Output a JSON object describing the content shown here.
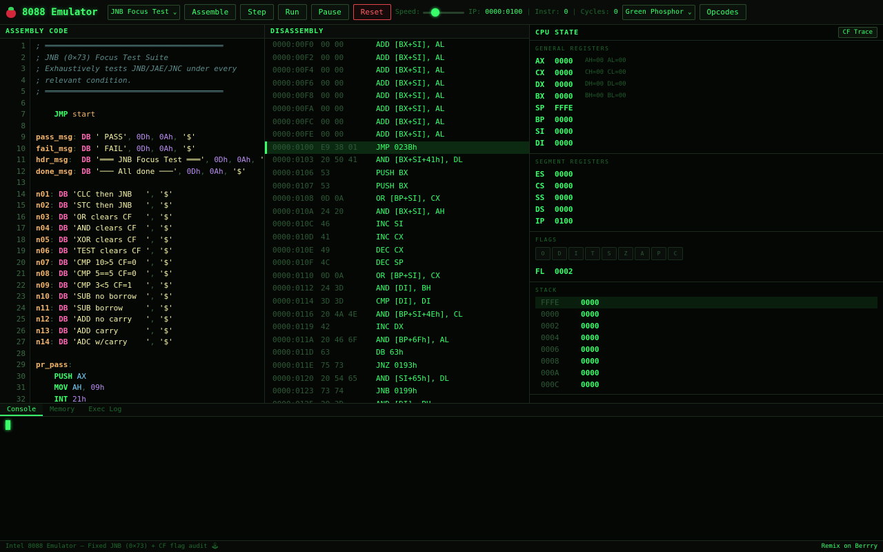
{
  "topbar": {
    "title": "8088 Emulator",
    "logo_icon": "strawberry-icon",
    "program_select": "JNB Focus Test",
    "assemble": "Assemble",
    "step": "Step",
    "run": "Run",
    "pause": "Pause",
    "reset": "Reset",
    "speed_label": "Speed:",
    "speed_level_fraction": 0.25,
    "ip_label": "IP:",
    "ip_value": "0000:0100",
    "instr_label": "Instr:",
    "instr_value": "0",
    "cycles_label": "Cycles:",
    "cycles_value": "0",
    "theme_select": "Green Phosphor",
    "opcodes": "Opcodes"
  },
  "code": {
    "header": "ASSEMBLY CODE",
    "lines": [
      [
        [
          "c",
          "; ═══════════════════════════════════════"
        ]
      ],
      [
        [
          "c",
          "; JNB (0×73) Focus Test Suite"
        ]
      ],
      [
        [
          "c",
          "; Exhaustively tests JNB/JAE/JNC under every"
        ]
      ],
      [
        [
          "c",
          "; relevant condition."
        ]
      ],
      [
        [
          "c",
          "; ═══════════════════════════════════════"
        ]
      ],
      [],
      [
        [
          "t",
          "    "
        ],
        [
          "o",
          "JMP"
        ],
        [
          "t",
          " "
        ],
        [
          "i",
          "start"
        ]
      ],
      [],
      [
        [
          "l",
          "pass_msg"
        ],
        [
          "p",
          ": "
        ],
        [
          "k",
          "DB"
        ],
        [
          "t",
          " "
        ],
        [
          "s",
          "' PASS'"
        ],
        [
          "p",
          ", "
        ],
        [
          "n",
          "0Dh"
        ],
        [
          "p",
          ", "
        ],
        [
          "n",
          "0Ah"
        ],
        [
          "p",
          ", "
        ],
        [
          "s",
          "'$'"
        ]
      ],
      [
        [
          "l",
          "fail_msg"
        ],
        [
          "p",
          ": "
        ],
        [
          "k",
          "DB"
        ],
        [
          "t",
          " "
        ],
        [
          "s",
          "' FAIL'"
        ],
        [
          "p",
          ", "
        ],
        [
          "n",
          "0Dh"
        ],
        [
          "p",
          ", "
        ],
        [
          "n",
          "0Ah"
        ],
        [
          "p",
          ", "
        ],
        [
          "s",
          "'$'"
        ]
      ],
      [
        [
          "l",
          "hdr_msg"
        ],
        [
          "p",
          ":  "
        ],
        [
          "k",
          "DB"
        ],
        [
          "t",
          " "
        ],
        [
          "s",
          "'═══ JNB Focus Test ═══'"
        ],
        [
          "p",
          ", "
        ],
        [
          "n",
          "0Dh"
        ],
        [
          "p",
          ", "
        ],
        [
          "n",
          "0Ah"
        ],
        [
          "p",
          ", "
        ],
        [
          "s",
          "'$'"
        ]
      ],
      [
        [
          "l",
          "done_msg"
        ],
        [
          "p",
          ": "
        ],
        [
          "k",
          "DB"
        ],
        [
          "t",
          " "
        ],
        [
          "s",
          "'─── All done ───'"
        ],
        [
          "p",
          ", "
        ],
        [
          "n",
          "0Dh"
        ],
        [
          "p",
          ", "
        ],
        [
          "n",
          "0Ah"
        ],
        [
          "p",
          ", "
        ],
        [
          "s",
          "'$'"
        ]
      ],
      [],
      [
        [
          "l",
          "n01"
        ],
        [
          "p",
          ": "
        ],
        [
          "k",
          "DB"
        ],
        [
          "t",
          " "
        ],
        [
          "s",
          "'CLC then JNB   '"
        ],
        [
          "p",
          ", "
        ],
        [
          "s",
          "'$'"
        ]
      ],
      [
        [
          "l",
          "n02"
        ],
        [
          "p",
          ": "
        ],
        [
          "k",
          "DB"
        ],
        [
          "t",
          " "
        ],
        [
          "s",
          "'STC then JNB   '"
        ],
        [
          "p",
          ", "
        ],
        [
          "s",
          "'$'"
        ]
      ],
      [
        [
          "l",
          "n03"
        ],
        [
          "p",
          ": "
        ],
        [
          "k",
          "DB"
        ],
        [
          "t",
          " "
        ],
        [
          "s",
          "'OR clears CF   '"
        ],
        [
          "p",
          ", "
        ],
        [
          "s",
          "'$'"
        ]
      ],
      [
        [
          "l",
          "n04"
        ],
        [
          "p",
          ": "
        ],
        [
          "k",
          "DB"
        ],
        [
          "t",
          " "
        ],
        [
          "s",
          "'AND clears CF  '"
        ],
        [
          "p",
          ", "
        ],
        [
          "s",
          "'$'"
        ]
      ],
      [
        [
          "l",
          "n05"
        ],
        [
          "p",
          ": "
        ],
        [
          "k",
          "DB"
        ],
        [
          "t",
          " "
        ],
        [
          "s",
          "'XOR clears CF  '"
        ],
        [
          "p",
          ", "
        ],
        [
          "s",
          "'$'"
        ]
      ],
      [
        [
          "l",
          "n06"
        ],
        [
          "p",
          ": "
        ],
        [
          "k",
          "DB"
        ],
        [
          "t",
          " "
        ],
        [
          "s",
          "'TEST clears CF '"
        ],
        [
          "p",
          ", "
        ],
        [
          "s",
          "'$'"
        ]
      ],
      [
        [
          "l",
          "n07"
        ],
        [
          "p",
          ": "
        ],
        [
          "k",
          "DB"
        ],
        [
          "t",
          " "
        ],
        [
          "s",
          "'CMP 10>5 CF=0  '"
        ],
        [
          "p",
          ", "
        ],
        [
          "s",
          "'$'"
        ]
      ],
      [
        [
          "l",
          "n08"
        ],
        [
          "p",
          ": "
        ],
        [
          "k",
          "DB"
        ],
        [
          "t",
          " "
        ],
        [
          "s",
          "'CMP 5==5 CF=0  '"
        ],
        [
          "p",
          ", "
        ],
        [
          "s",
          "'$'"
        ]
      ],
      [
        [
          "l",
          "n09"
        ],
        [
          "p",
          ": "
        ],
        [
          "k",
          "DB"
        ],
        [
          "t",
          " "
        ],
        [
          "s",
          "'CMP 3<5 CF=1   '"
        ],
        [
          "p",
          ", "
        ],
        [
          "s",
          "'$'"
        ]
      ],
      [
        [
          "l",
          "n10"
        ],
        [
          "p",
          ": "
        ],
        [
          "k",
          "DB"
        ],
        [
          "t",
          " "
        ],
        [
          "s",
          "'SUB no borrow  '"
        ],
        [
          "p",
          ", "
        ],
        [
          "s",
          "'$'"
        ]
      ],
      [
        [
          "l",
          "n11"
        ],
        [
          "p",
          ": "
        ],
        [
          "k",
          "DB"
        ],
        [
          "t",
          " "
        ],
        [
          "s",
          "'SUB borrow     '"
        ],
        [
          "p",
          ", "
        ],
        [
          "s",
          "'$'"
        ]
      ],
      [
        [
          "l",
          "n12"
        ],
        [
          "p",
          ": "
        ],
        [
          "k",
          "DB"
        ],
        [
          "t",
          " "
        ],
        [
          "s",
          "'ADD no carry   '"
        ],
        [
          "p",
          ", "
        ],
        [
          "s",
          "'$'"
        ]
      ],
      [
        [
          "l",
          "n13"
        ],
        [
          "p",
          ": "
        ],
        [
          "k",
          "DB"
        ],
        [
          "t",
          " "
        ],
        [
          "s",
          "'ADD carry      '"
        ],
        [
          "p",
          ", "
        ],
        [
          "s",
          "'$'"
        ]
      ],
      [
        [
          "l",
          "n14"
        ],
        [
          "p",
          ": "
        ],
        [
          "k",
          "DB"
        ],
        [
          "t",
          " "
        ],
        [
          "s",
          "'ADC w/carry    '"
        ],
        [
          "p",
          ", "
        ],
        [
          "s",
          "'$'"
        ]
      ],
      [],
      [
        [
          "l",
          "pr_pass"
        ],
        [
          "p",
          ":"
        ]
      ],
      [
        [
          "t",
          "    "
        ],
        [
          "o",
          "PUSH"
        ],
        [
          "t",
          " "
        ],
        [
          "r",
          "AX"
        ]
      ],
      [
        [
          "t",
          "    "
        ],
        [
          "o",
          "MOV"
        ],
        [
          "t",
          " "
        ],
        [
          "r",
          "AH"
        ],
        [
          "p",
          ", "
        ],
        [
          "n",
          "09h"
        ]
      ],
      [
        [
          "t",
          "    "
        ],
        [
          "o",
          "INT"
        ],
        [
          "t",
          " "
        ],
        [
          "n",
          "21h"
        ]
      ]
    ]
  },
  "disassembly": {
    "header": "DISASSEMBLY",
    "current_index": 8,
    "rows": [
      {
        "addr": "0000:00F0",
        "bytes": "00 00",
        "ins": "ADD [BX+SI], AL"
      },
      {
        "addr": "0000:00F2",
        "bytes": "00 00",
        "ins": "ADD [BX+SI], AL"
      },
      {
        "addr": "0000:00F4",
        "bytes": "00 00",
        "ins": "ADD [BX+SI], AL"
      },
      {
        "addr": "0000:00F6",
        "bytes": "00 00",
        "ins": "ADD [BX+SI], AL"
      },
      {
        "addr": "0000:00F8",
        "bytes": "00 00",
        "ins": "ADD [BX+SI], AL"
      },
      {
        "addr": "0000:00FA",
        "bytes": "00 00",
        "ins": "ADD [BX+SI], AL"
      },
      {
        "addr": "0000:00FC",
        "bytes": "00 00",
        "ins": "ADD [BX+SI], AL"
      },
      {
        "addr": "0000:00FE",
        "bytes": "00 00",
        "ins": "ADD [BX+SI], AL"
      },
      {
        "addr": "0000:0100",
        "bytes": "E9 38 01",
        "ins": "JMP 023Bh"
      },
      {
        "addr": "0000:0103",
        "bytes": "20 50 41",
        "ins": "AND [BX+SI+41h], DL"
      },
      {
        "addr": "0000:0106",
        "bytes": "53",
        "ins": "PUSH BX"
      },
      {
        "addr": "0000:0107",
        "bytes": "53",
        "ins": "PUSH BX"
      },
      {
        "addr": "0000:0108",
        "bytes": "0D 0A",
        "ins": "OR [BP+SI], CX"
      },
      {
        "addr": "0000:010A",
        "bytes": "24 20",
        "ins": "AND [BX+SI], AH"
      },
      {
        "addr": "0000:010C",
        "bytes": "46",
        "ins": "INC SI"
      },
      {
        "addr": "0000:010D",
        "bytes": "41",
        "ins": "INC CX"
      },
      {
        "addr": "0000:010E",
        "bytes": "49",
        "ins": "DEC CX"
      },
      {
        "addr": "0000:010F",
        "bytes": "4C",
        "ins": "DEC SP"
      },
      {
        "addr": "0000:0110",
        "bytes": "0D 0A",
        "ins": "OR [BP+SI], CX"
      },
      {
        "addr": "0000:0112",
        "bytes": "24 3D",
        "ins": "AND [DI], BH"
      },
      {
        "addr": "0000:0114",
        "bytes": "3D 3D",
        "ins": "CMP [DI], DI"
      },
      {
        "addr": "0000:0116",
        "bytes": "20 4A 4E",
        "ins": "AND [BP+SI+4Eh], CL"
      },
      {
        "addr": "0000:0119",
        "bytes": "42",
        "ins": "INC DX"
      },
      {
        "addr": "0000:011A",
        "bytes": "20 46 6F",
        "ins": "AND [BP+6Fh], AL"
      },
      {
        "addr": "0000:011D",
        "bytes": "63",
        "ins": "DB 63h"
      },
      {
        "addr": "0000:011E",
        "bytes": "75 73",
        "ins": "JNZ 0193h"
      },
      {
        "addr": "0000:0120",
        "bytes": "20 54 65",
        "ins": "AND [SI+65h], DL"
      },
      {
        "addr": "0000:0123",
        "bytes": "73 74",
        "ins": "JNB 0199h"
      },
      {
        "addr": "0000:0125",
        "bytes": "20 3D",
        "ins": "AND [DI], BH"
      }
    ]
  },
  "cpu": {
    "header": "CPU STATE",
    "cf_trace": "CF Trace",
    "general_title": "GENERAL REGISTERS",
    "general": [
      {
        "name": "AX",
        "value": "0000",
        "sub": "AH=00 AL=00"
      },
      {
        "name": "CX",
        "value": "0000",
        "sub": "CH=00 CL=00"
      },
      {
        "name": "DX",
        "value": "0000",
        "sub": "DH=00 DL=00"
      },
      {
        "name": "BX",
        "value": "0000",
        "sub": "BH=00 BL=00"
      },
      {
        "name": "SP",
        "value": "FFFE",
        "sub": ""
      },
      {
        "name": "BP",
        "value": "0000",
        "sub": ""
      },
      {
        "name": "SI",
        "value": "0000",
        "sub": ""
      },
      {
        "name": "DI",
        "value": "0000",
        "sub": ""
      }
    ],
    "segment_title": "SEGMENT REGISTERS",
    "segment": [
      {
        "name": "ES",
        "value": "0000"
      },
      {
        "name": "CS",
        "value": "0000"
      },
      {
        "name": "SS",
        "value": "0000"
      },
      {
        "name": "DS",
        "value": "0000"
      },
      {
        "name": "IP",
        "value": "0100"
      }
    ],
    "flags_title": "FLAGS",
    "flags": [
      "O",
      "D",
      "I",
      "T",
      "S",
      "Z",
      "A",
      "P",
      "C"
    ],
    "fl_name": "FL",
    "fl_value": "0002",
    "stack_title": "STACK",
    "stack": [
      {
        "addr": "FFFE",
        "value": "0000"
      },
      {
        "addr": "0000",
        "value": "0000"
      },
      {
        "addr": "0002",
        "value": "0000"
      },
      {
        "addr": "0004",
        "value": "0000"
      },
      {
        "addr": "0006",
        "value": "0000"
      },
      {
        "addr": "0008",
        "value": "0000"
      },
      {
        "addr": "000A",
        "value": "0000"
      },
      {
        "addr": "000C",
        "value": "0000"
      }
    ]
  },
  "console": {
    "tabs": [
      "Console",
      "Memory",
      "Exec Log"
    ],
    "active_tab": 0
  },
  "footer": {
    "left": "Intel 8088 Emulator — Fixed JNB (0×73) + CF flag audit 🕹",
    "right": "Remix on Berrry"
  },
  "colors": {
    "phosphor": "#39ff6a",
    "dim": "#1d6a2c",
    "background": "#050705",
    "reset": "#ff5b60"
  }
}
